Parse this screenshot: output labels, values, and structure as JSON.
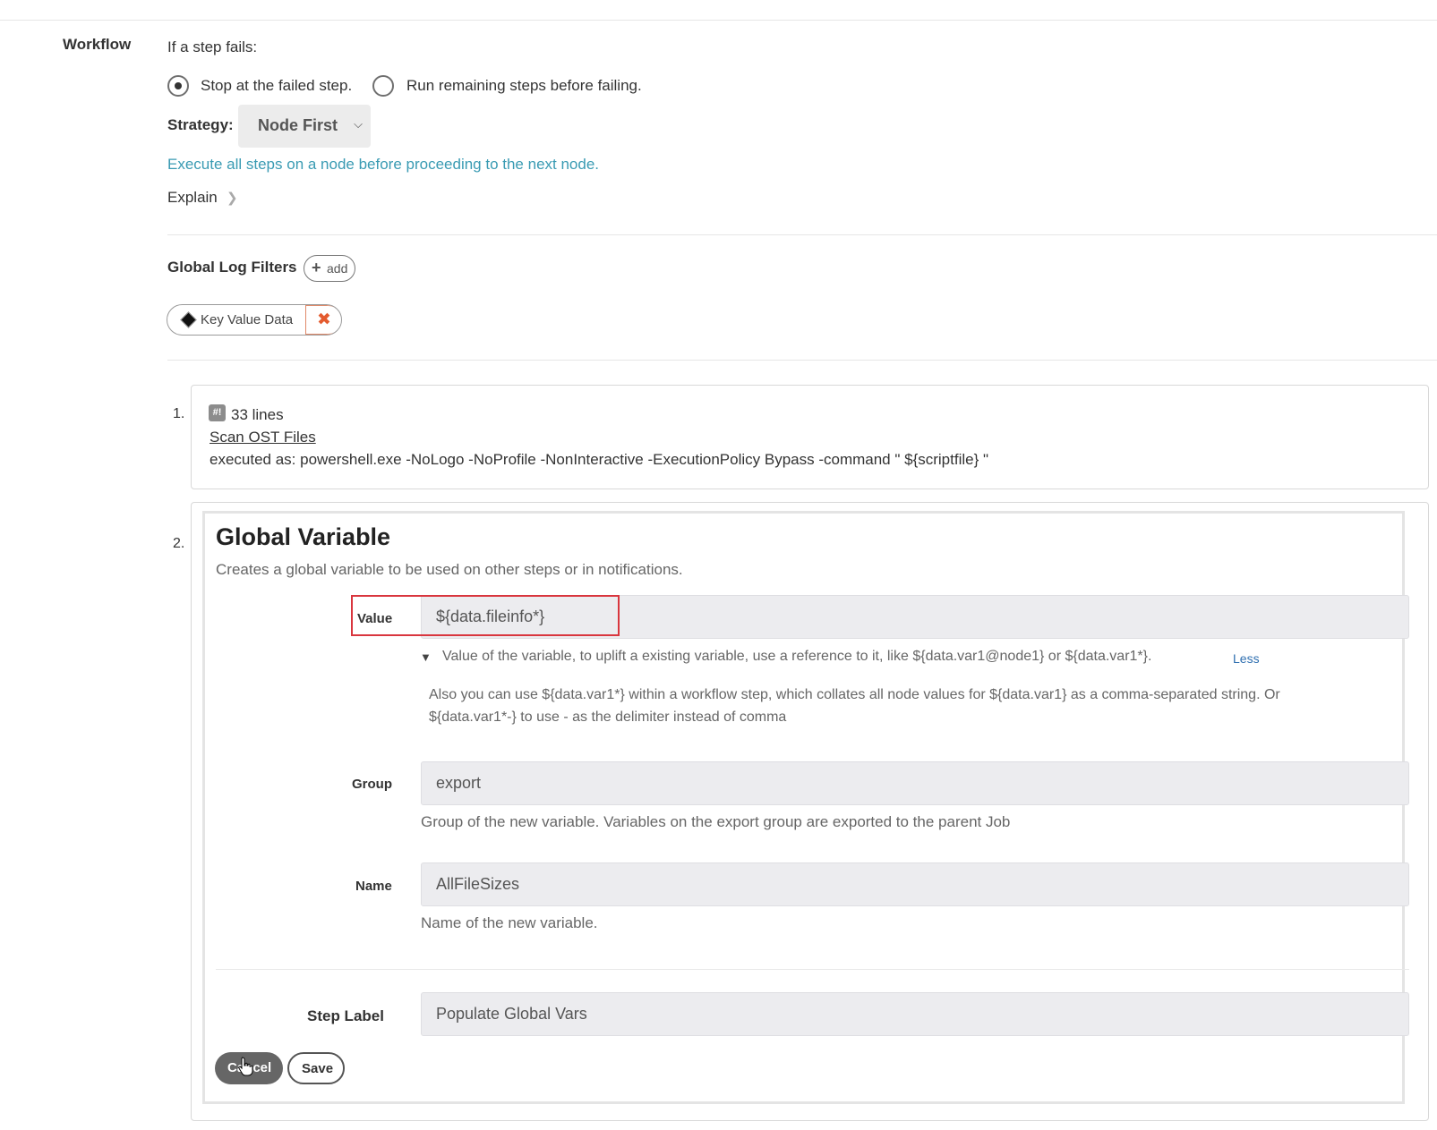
{
  "workflow": {
    "section_label": "Workflow",
    "fail_prompt": "If a step fails:",
    "fail_options": [
      {
        "label": "Stop at the failed step.",
        "selected": true
      },
      {
        "label": "Run remaining steps before failing.",
        "selected": false
      }
    ],
    "strategy_label": "Strategy:",
    "strategy_value": "Node First",
    "strategy_description": "Execute all steps on a node before proceeding to the next node.",
    "explain_label": "Explain"
  },
  "log_filters": {
    "title": "Global Log Filters",
    "add_label": "add",
    "items": [
      {
        "label": "Key Value Data"
      }
    ]
  },
  "steps": [
    {
      "number": "1.",
      "lines_label": "33 lines",
      "name": "Scan OST Files",
      "executed_as": "executed as: powershell.exe -NoLogo -NoProfile -NonInteractive -ExecutionPolicy Bypass -command \" ${scriptfile} \""
    },
    {
      "number": "2.",
      "title": "Global Variable",
      "description": "Creates a global variable to be used on other steps or in notifications.",
      "fields": {
        "value": {
          "label": "Value",
          "value": "${data.fileinfo*}",
          "help": "Value of the variable, to uplift a existing variable, use a reference to it, like ${data.var1@node1} or ${data.var1*}.",
          "help_toggle": "Less",
          "help_extra_line1": "Also you can use ${data.var1*} within a workflow step, which collates all node values for ${data.var1} as a comma-separated string. Or",
          "help_extra_line2": "${data.var1*-} to use - as the delimiter instead of comma"
        },
        "group": {
          "label": "Group",
          "value": "export",
          "help": "Group of the new variable. Variables on the export group are exported to the parent Job"
        },
        "name": {
          "label": "Name",
          "value": "AllFileSizes",
          "help": "Name of the new variable."
        },
        "step_label": {
          "label": "Step Label",
          "value": "Populate Global Vars"
        }
      },
      "buttons": {
        "cancel": "Cancel",
        "save": "Save"
      }
    }
  ]
}
